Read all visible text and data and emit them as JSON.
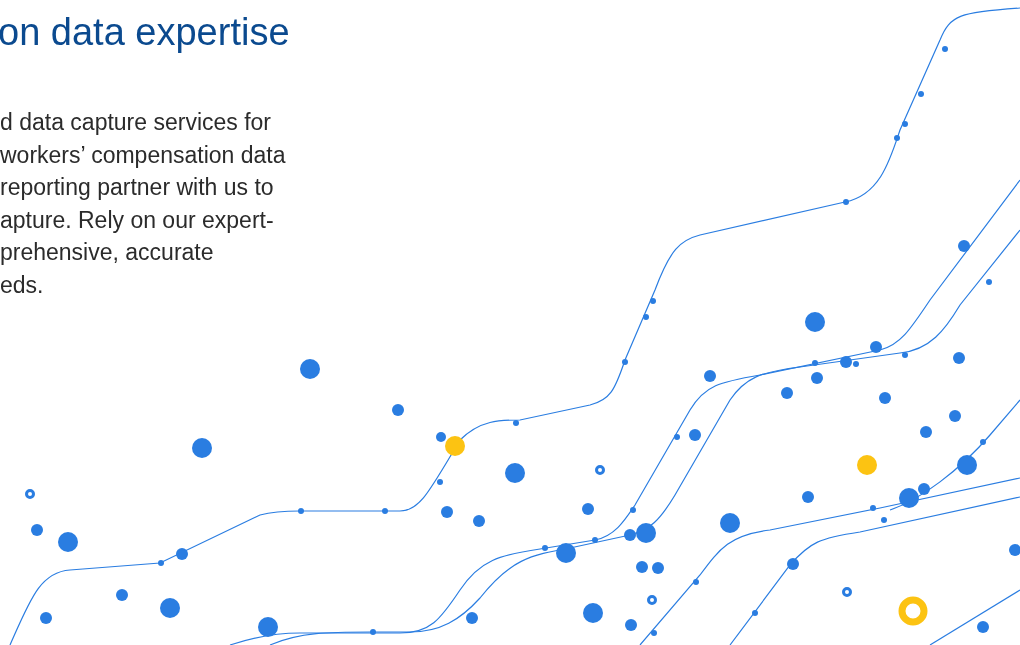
{
  "heading": "on data expertise",
  "paragraph_lines": [
    "d data capture services for",
    "workers’ compensation data",
    "reporting partner with us to",
    "apture. Rely on our expert-",
    "prehensive, accurate",
    "eds."
  ]
}
